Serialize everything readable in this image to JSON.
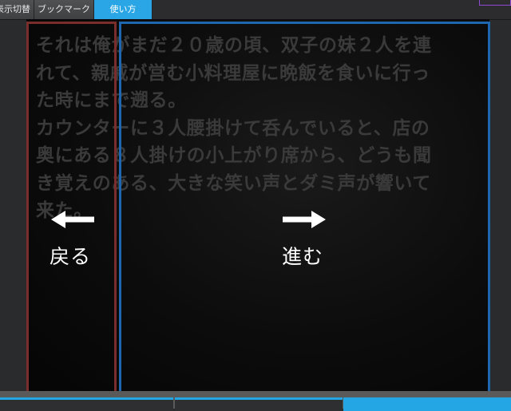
{
  "tabs": [
    {
      "label": "表示切替",
      "active": false
    },
    {
      "label": "ブックマーク",
      "active": false
    },
    {
      "label": "使い方",
      "active": true
    }
  ],
  "story": {
    "lines": [
      "それは俺がまだ２０歳の頃、双子の妹２人を連",
      "れて、親戚が営む小料理屋に晩飯を食いに行っ",
      "た時にまで遡る。",
      "カウンターに３人腰掛けて呑んでいると、店の",
      "奥にある８人掛けの小上がり席から、どうも聞",
      "き覚えのある、大きな笑い声とダミ声が響いて",
      "来た。"
    ]
  },
  "guide": {
    "back_label": "戻る",
    "forward_label": "進む"
  },
  "colors": {
    "active_tab": "#2aa6e6",
    "back_zone": "#7a2e2c",
    "forward_zone": "#1f66b0",
    "progress": "#25a6e4"
  },
  "icons": {
    "back": "arrow-left-icon",
    "forward": "arrow-right-icon"
  }
}
